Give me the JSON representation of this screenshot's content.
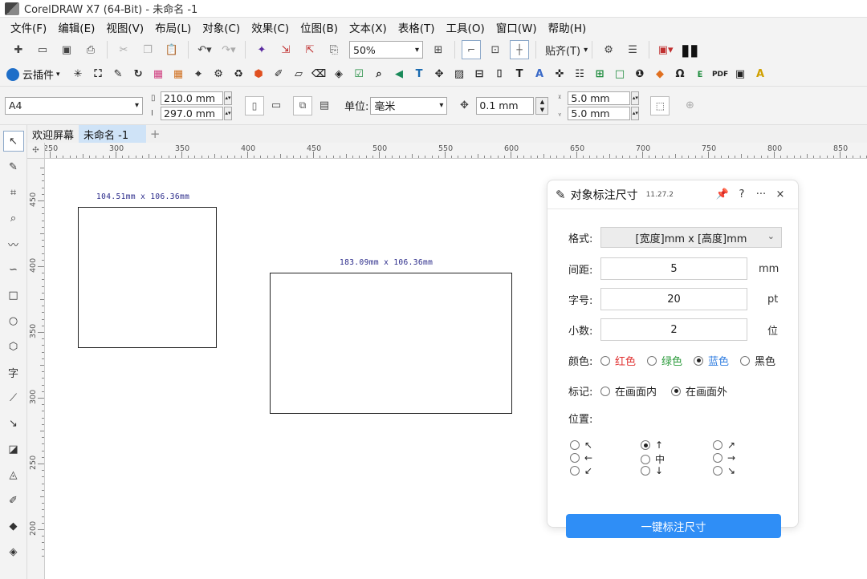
{
  "window": {
    "title": "CorelDRAW X7 (64-Bit) - 未命名 -1"
  },
  "menubar": {
    "items": [
      "文件(F)",
      "编辑(E)",
      "视图(V)",
      "布局(L)",
      "对象(C)",
      "效果(C)",
      "位图(B)",
      "文本(X)",
      "表格(T)",
      "工具(O)",
      "窗口(W)",
      "帮助(H)"
    ]
  },
  "toolbar": {
    "zoom": "50%",
    "snap_label": "贴齐(T)"
  },
  "plugin_bar": {
    "label": "云插件"
  },
  "property_bar": {
    "page_size": "A4",
    "width": "210.0 mm",
    "height": "297.0 mm",
    "unit_label": "单位:",
    "unit_value": "毫米",
    "nudge": "0.1 mm",
    "dup_x": "5.0 mm",
    "dup_y": "5.0 mm"
  },
  "doc_tabs": {
    "welcome": "欢迎屏幕",
    "document": "未命名 -1"
  },
  "ruler": {
    "h_labels": [
      "250",
      "300",
      "350",
      "400",
      "450",
      "500",
      "550",
      "600",
      "650",
      "700",
      "750",
      "800",
      "850"
    ],
    "v_labels": [
      "450",
      "400",
      "350",
      "300",
      "250",
      "200"
    ]
  },
  "canvas": {
    "shape1_label": "104.51mm x 106.36mm",
    "shape2_label": "183.09mm x 106.36mm"
  },
  "docker": {
    "title": "对象标注尺寸",
    "version": "11.27.2",
    "help": "?",
    "more": "···",
    "close": "×",
    "format_label": "格式:",
    "format_value": "[宽度]mm x [高度]mm",
    "spacing_label": "间距:",
    "spacing_value": "5",
    "spacing_unit": "mm",
    "fontsize_label": "字号:",
    "fontsize_value": "20",
    "fontsize_unit": "pt",
    "decimal_label": "小数:",
    "decimal_value": "2",
    "decimal_unit": "位",
    "color_label": "颜色:",
    "colors": [
      {
        "label": "红色",
        "color": "#e03030",
        "checked": false
      },
      {
        "label": "绿色",
        "color": "#2a9a3a",
        "checked": false
      },
      {
        "label": "蓝色",
        "color": "#2f7de0",
        "checked": true
      },
      {
        "label": "黑色",
        "color": "#222222",
        "checked": false
      }
    ],
    "mark_label": "标记:",
    "mark_inside": "在画面内",
    "mark_outside": "在画面外",
    "mark_selected": "outside",
    "position_label": "位置:",
    "positions": [
      "↖",
      "↑",
      "↗",
      "←",
      "中",
      "→",
      "↙",
      "↓",
      "↘"
    ],
    "position_selected": "↑",
    "button_label": "一键标注尺寸"
  }
}
